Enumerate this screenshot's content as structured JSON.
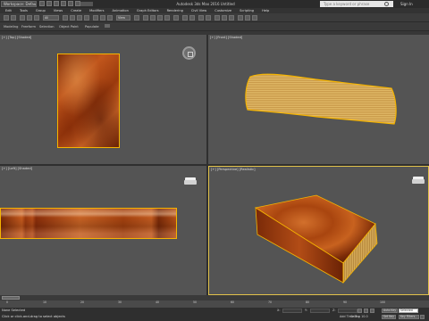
{
  "titlebar": {
    "workspace": "Workspace: Default",
    "app_title": "Autodesk 3ds Max 2016    Untitled",
    "search_placeholder": "Type a keyword or phrase",
    "sign_in": "Sign In"
  },
  "menubar": {
    "items": [
      "Edit",
      "Tools",
      "Group",
      "Views",
      "Create",
      "Modifiers",
      "Animation",
      "Graph Editors",
      "Rendering",
      "Civil View",
      "Customize",
      "Scripting",
      "Help"
    ]
  },
  "toolbar": {
    "selection_filter": "All",
    "view_dropdown": "View"
  },
  "ribbon": {
    "tabs": [
      "Modeling",
      "Freeform",
      "Selection",
      "Object Paint",
      "Populate"
    ]
  },
  "viewports": {
    "top_label": "[+] [Top] [Shaded]",
    "front_label": "[+] [Front] [Shaded]",
    "left_label": "[+] [Left] [Shaded]",
    "perspective_label": "[+] [Perspective] [Realistic]"
  },
  "timeline": {
    "slider": "0 / 100",
    "ticks": [
      "0",
      "10",
      "20",
      "30",
      "40",
      "50",
      "60",
      "70",
      "80",
      "90",
      "100"
    ]
  },
  "status": {
    "selection": "None Selected",
    "prompt": "Click or click-and-drag to select objects",
    "x_label": "X:",
    "y_label": "Y:",
    "z_label": "Z:",
    "grid": "Grid = 10.0",
    "auto_key": "Auto Key",
    "selected": "Selected",
    "set_key": "Set Key",
    "key_filters": "Key Filters...",
    "add_time_tag": "Add Time Tag"
  }
}
